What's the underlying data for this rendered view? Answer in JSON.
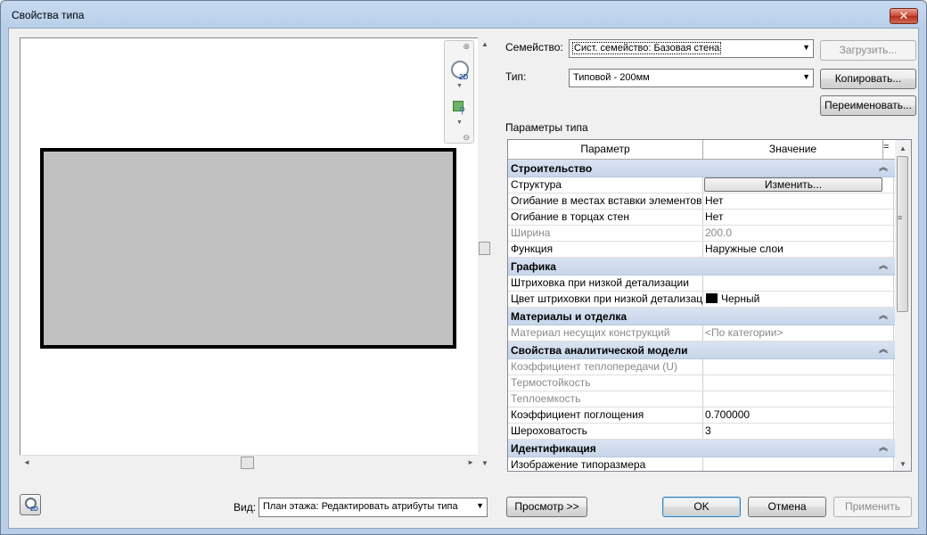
{
  "window": {
    "title": "Свойства типа",
    "close_glyph": "✕"
  },
  "family": {
    "label": "Семейство:",
    "value": "Сист. семейство: Базовая стена"
  },
  "type": {
    "label": "Тип:",
    "value": "Типовой - 200мм"
  },
  "buttons": {
    "load": "Загрузить...",
    "copy": "Копировать...",
    "rename": "Переименовать...",
    "preview": "Просмотр >>",
    "ok": "OK",
    "cancel": "Отмена",
    "apply": "Применить"
  },
  "params_title": "Параметры типа",
  "table": {
    "headers": [
      "Параметр",
      "Значение"
    ],
    "groups": [
      {
        "title": "Строительство",
        "rows": [
          {
            "name": "Структура",
            "value": "Изменить...",
            "kind": "button"
          },
          {
            "name": "Огибание в местах вставки элементов",
            "value": "Нет"
          },
          {
            "name": "Огибание в торцах стен",
            "value": "Нет"
          },
          {
            "name": "Ширина",
            "value": "200.0",
            "gray": true
          },
          {
            "name": "Функция",
            "value": "Наружные слои"
          }
        ]
      },
      {
        "title": "Графика",
        "rows": [
          {
            "name": "Штриховка при низкой детализации",
            "value": ""
          },
          {
            "name": "Цвет штриховки при низкой детализации",
            "value": "Черный",
            "kind": "color",
            "color": "#000000"
          }
        ]
      },
      {
        "title": "Материалы и отделка",
        "rows": [
          {
            "name": "Материал несущих конструкций",
            "value": "<По категории>",
            "gray": true
          }
        ]
      },
      {
        "title": "Свойства аналитической модели",
        "rows": [
          {
            "name": "Коэффициент теплопередачи (U)",
            "value": "",
            "gray": true
          },
          {
            "name": "Термостойкость",
            "value": "",
            "gray": true
          },
          {
            "name": "Теплоемкость",
            "value": "",
            "gray": true
          },
          {
            "name": "Коэффициент поглощения",
            "value": "0.700000"
          },
          {
            "name": "Шероховатость",
            "value": "3"
          }
        ]
      },
      {
        "title": "Идентификация",
        "rows": [
          {
            "name": "Изображение типоразмера",
            "value": ""
          }
        ]
      }
    ]
  },
  "view": {
    "label": "Вид:",
    "value": "План этажа: Редактировать атрибуты типа"
  },
  "navbar": {
    "wheel_label": "2D"
  },
  "colors": {
    "group_bg": "#cdd9ec",
    "wall_fill": "#c0c0c0",
    "title_bar": "#c7daf0"
  }
}
